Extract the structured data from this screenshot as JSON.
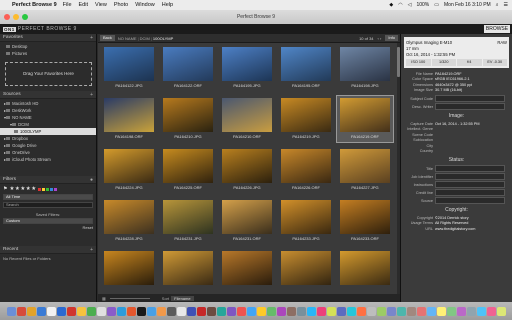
{
  "menubar": {
    "app": "Perfect Browse 9",
    "items": [
      "File",
      "Edit",
      "View",
      "Photo",
      "Window",
      "Help"
    ],
    "battery": "100%",
    "clock": "Mon Feb 16  3:10 PM"
  },
  "window_title": "Perfect Browse 9",
  "appbar": {
    "logo_mark": "ON1",
    "logo_text": "PERFECT BROWSE 9",
    "browse_label": "BROWSE"
  },
  "sidebar": {
    "favorites": {
      "title": "Favorites",
      "add": "+",
      "items": [
        "Desktop",
        "Pictures"
      ],
      "drag_hint": "Drag Your Favorites Here"
    },
    "sources": {
      "title": "Sources",
      "add": "+",
      "items": [
        "Macintosh HD",
        "DeskWork",
        "NO NAME",
        "DCIM",
        "100OLYMP",
        "Dropbox",
        "Google Drive",
        "OneDrive",
        "iCloud Photo Stream"
      ]
    },
    "filters": {
      "title": "Filters",
      "all_time": "All Time",
      "search_placeholder": "Search",
      "saved_label": "Saved Filters:",
      "saved_value": "Custom",
      "reset": "Reset"
    },
    "recent": {
      "title": "Recent",
      "add": "+",
      "empty": "No Recent Files or Folders"
    }
  },
  "content": {
    "back": "Back",
    "breadcrumb": [
      "NO NAME",
      "DCIM",
      "100OLYMP"
    ],
    "counter": "10 of 34",
    "info_tab": "Info",
    "thumbnails": [
      {
        "name": "PA164122.JPG",
        "c1": "#3b6fb0",
        "c2": "#1d3350"
      },
      {
        "name": "PA164122.ORF",
        "c1": "#4a7cc0",
        "c2": "#233a5a"
      },
      {
        "name": "PA164195.JPG",
        "c1": "#4d80c6",
        "c2": "#1d3555"
      },
      {
        "name": "PA164195.ORF",
        "c1": "#5086c8",
        "c2": "#223a58"
      },
      {
        "name": "PA164198.JPG",
        "c1": "#6f86a5",
        "c2": "#2a3344"
      },
      {
        "name": "PA164198.ORF",
        "c1": "#2a3b66",
        "c2": "#c9a23a"
      },
      {
        "name": "PA164210.JPG",
        "c1": "#b77a1e",
        "c2": "#2a2210"
      },
      {
        "name": "PA164210.ORF",
        "c1": "#4a5770",
        "c2": "#c99d40"
      },
      {
        "name": "PA164219.JPG",
        "c1": "#c88a24",
        "c2": "#3a2a12"
      },
      {
        "name": "PA164219.ORF",
        "c1": "#d29b32",
        "c2": "#43301a"
      },
      {
        "name": "PA164224.JPG",
        "c1": "#d49b2c",
        "c2": "#3a2a14"
      },
      {
        "name": "PA164225.ORF",
        "c1": "#c68b1f",
        "c2": "#30220e"
      },
      {
        "name": "PA164226.JPG",
        "c1": "#b9801f",
        "c2": "#2c200d"
      },
      {
        "name": "PA164226.ORF",
        "c1": "#c8882a",
        "c2": "#3a2812"
      },
      {
        "name": "PA164227.JPG",
        "c1": "#d09a3a",
        "c2": "#5a4020"
      },
      {
        "name": "PA164228.JPG",
        "c1": "#c88a2a",
        "c2": "#3c3020"
      },
      {
        "name": "PA164231.JPG",
        "c1": "#b8953a",
        "c2": "#2e3320"
      },
      {
        "name": "PA164231.ORF",
        "c1": "#d4a04a",
        "c2": "#3a2e1c"
      },
      {
        "name": "PA164233.JPG",
        "c1": "#d2902a",
        "c2": "#3a2810"
      },
      {
        "name": "PA164233.ORF",
        "c1": "#c47e22",
        "c2": "#2e1f0c"
      },
      {
        "name": "",
        "c1": "#c8861f",
        "c2": "#2a1d0b"
      },
      {
        "name": "",
        "c1": "#d09a36",
        "c2": "#3a2a14"
      },
      {
        "name": "",
        "c1": "#b8782a",
        "c2": "#2a1c0c"
      },
      {
        "name": "",
        "c1": "#c88e30",
        "c2": "#322410"
      },
      {
        "name": "",
        "c1": "#d49a2e",
        "c2": "#3a2a12"
      }
    ],
    "selected_index": 9,
    "sort_label": "Sort",
    "sort_value": "Filename"
  },
  "info": {
    "camera": "Olympus Imaging E-M10",
    "format": "RAW",
    "focal": "17 mm",
    "datetime": "Oct 16, 2014 - 1:32:55 PM",
    "iso": "ISO 100",
    "shutter": "1/320",
    "aperture": "f/4",
    "ev": "EV -0.30",
    "file_rows": [
      {
        "k": "File Name",
        "v": "PA164219.ORF"
      },
      {
        "k": "Color Space",
        "v": "sRGB IEC61966-2.1"
      },
      {
        "k": "Dimensions",
        "v": "4640x3472 @ 350 ppi"
      },
      {
        "k": "Image Size",
        "v": "30.7 MB (16-bit)"
      }
    ],
    "desc_fields": [
      "Subject Code",
      "Desc. Writer"
    ],
    "image_title": "Image:",
    "image_rows": [
      {
        "k": "Capture Date",
        "v": "Oct 16, 2014 - 1:32:55 PM"
      },
      {
        "k": "Intellect. Genre",
        "v": ""
      },
      {
        "k": "Scene Code",
        "v": ""
      },
      {
        "k": "Sublocation",
        "v": ""
      },
      {
        "k": "City",
        "v": ""
      },
      {
        "k": "Country",
        "v": ""
      }
    ],
    "status_title": "Status:",
    "status_fields": [
      "Title",
      "Job Identifier",
      "Instructions",
      "Credit line",
      "Source"
    ],
    "copyright_title": "Copyright:",
    "copyright_rows": [
      {
        "k": "Copyright",
        "v": "©2014 Derrick story"
      },
      {
        "k": "Usage Terms",
        "v": "All Rights Reserved"
      },
      {
        "k": "URL",
        "v": "www.thedigitalstory.com"
      }
    ]
  },
  "dock_colors": [
    "#6b8fd6",
    "#d64b3b",
    "#e3a32a",
    "#3a7bd5",
    "#f2f2f2",
    "#2b6ad1",
    "#d0362e",
    "#f6c23e",
    "#4cae4f",
    "#e0e0e0",
    "#8a5cc9",
    "#2d9cdb",
    "#e4572e",
    "#1a1a1a",
    "#49a0e6",
    "#f2994a",
    "#5b5b5b",
    "#e8e8e8",
    "#3f51b5",
    "#c62828",
    "#6d4c41",
    "#26a69a",
    "#7e57c2",
    "#ef5350",
    "#42a5f5",
    "#ffca28",
    "#66bb6a",
    "#ab47bc",
    "#8d6e63",
    "#78909c",
    "#29b6f6",
    "#ec407a",
    "#d4e157",
    "#5c6bc0",
    "#26c6da",
    "#ff7043",
    "#bdbdbd",
    "#9ccc65",
    "#7986cb",
    "#4db6ac",
    "#a1887f",
    "#e57373",
    "#64b5f6",
    "#fff176",
    "#81c784",
    "#ba68c8",
    "#90a4ae",
    "#4fc3f7",
    "#f06292",
    "#dce775"
  ]
}
